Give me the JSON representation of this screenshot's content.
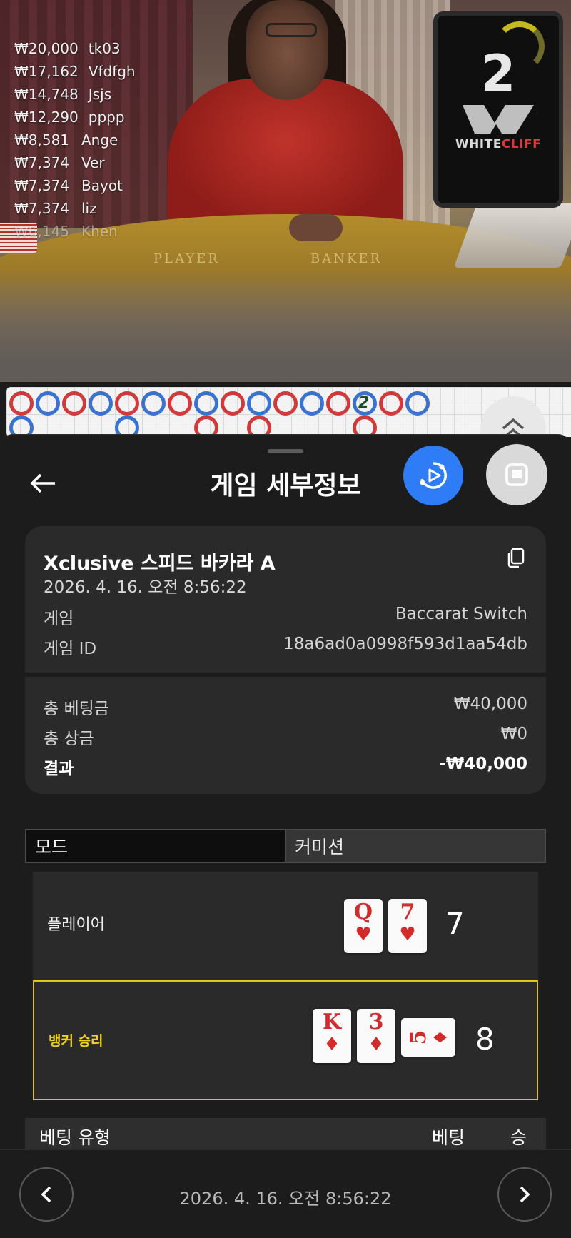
{
  "stream": {
    "leaderboard": [
      {
        "amount": "₩20,000",
        "name": "tk03"
      },
      {
        "amount": "₩17,162",
        "name": "Vfdfgh"
      },
      {
        "amount": "₩14,748",
        "name": "Jsjs"
      },
      {
        "amount": "₩12,290",
        "name": "pppp"
      },
      {
        "amount": "₩8,581",
        "name": "Ange"
      },
      {
        "amount": "₩7,374",
        "name": "Ver"
      },
      {
        "amount": "₩7,374",
        "name": "Bayot"
      },
      {
        "amount": "₩7,374",
        "name": "liz"
      },
      {
        "amount": "₩6,145",
        "name": "Khen"
      }
    ],
    "table_labels": {
      "player": "PLAYER",
      "banker": "BANKER"
    },
    "monitor_number": "2",
    "brand": {
      "white": "WHITE",
      "red": "CLIFF"
    }
  },
  "roadmap": {
    "top_row": [
      "B",
      "P",
      "B",
      "P",
      "B",
      "P",
      "B",
      "P",
      "B",
      "P",
      "B",
      "P",
      "B",
      "P",
      "B",
      "P"
    ],
    "bottom_row": {
      "cols": [
        1,
        5,
        8,
        10,
        14
      ],
      "types": [
        "P",
        "P",
        "B",
        "B",
        "B"
      ]
    },
    "tie_label": "2"
  },
  "sheet": {
    "title": "게임 세부정보",
    "info": {
      "game_name": "Xclusive 스피드 바카라 A",
      "timestamp": "2026. 4. 16. 오전 8:56:22",
      "game_label": "게임",
      "game_value": "Baccarat Switch",
      "game_id_label": "게임 ID",
      "game_id_value": "18a6ad0a0998f593d1aa54db",
      "total_bet_label": "총 베팅금",
      "total_bet_value": "₩40,000",
      "total_win_label": "총 상금",
      "total_win_value": "₩0",
      "result_label": "결과",
      "result_value": "-₩40,000"
    },
    "tabs": [
      {
        "label": "모드",
        "active": true
      },
      {
        "label": "커미션",
        "active": false
      }
    ],
    "hands": {
      "player": {
        "label": "플레이어",
        "score": "7",
        "cards": [
          {
            "rank": "Q",
            "suit": "♥"
          },
          {
            "rank": "7",
            "suit": "♥"
          }
        ]
      },
      "banker": {
        "label": "뱅커 승리",
        "score": "8",
        "cards": [
          {
            "rank": "K",
            "suit": "♦"
          },
          {
            "rank": "3",
            "suit": "♦"
          },
          {
            "rank": "5",
            "suit": "♦"
          }
        ]
      }
    },
    "bet_table": {
      "headers": [
        "베팅 유형",
        "베팅",
        "승"
      ]
    }
  },
  "footer": {
    "date": "2026. 4. 16. 오전 8:56:22"
  },
  "colors": {
    "accent_blue": "#2e7cf6",
    "win_yellow": "#e3c21c",
    "card_red": "#d12b2b",
    "road_player": "#3a73cf",
    "road_banker": "#d03a3a"
  }
}
